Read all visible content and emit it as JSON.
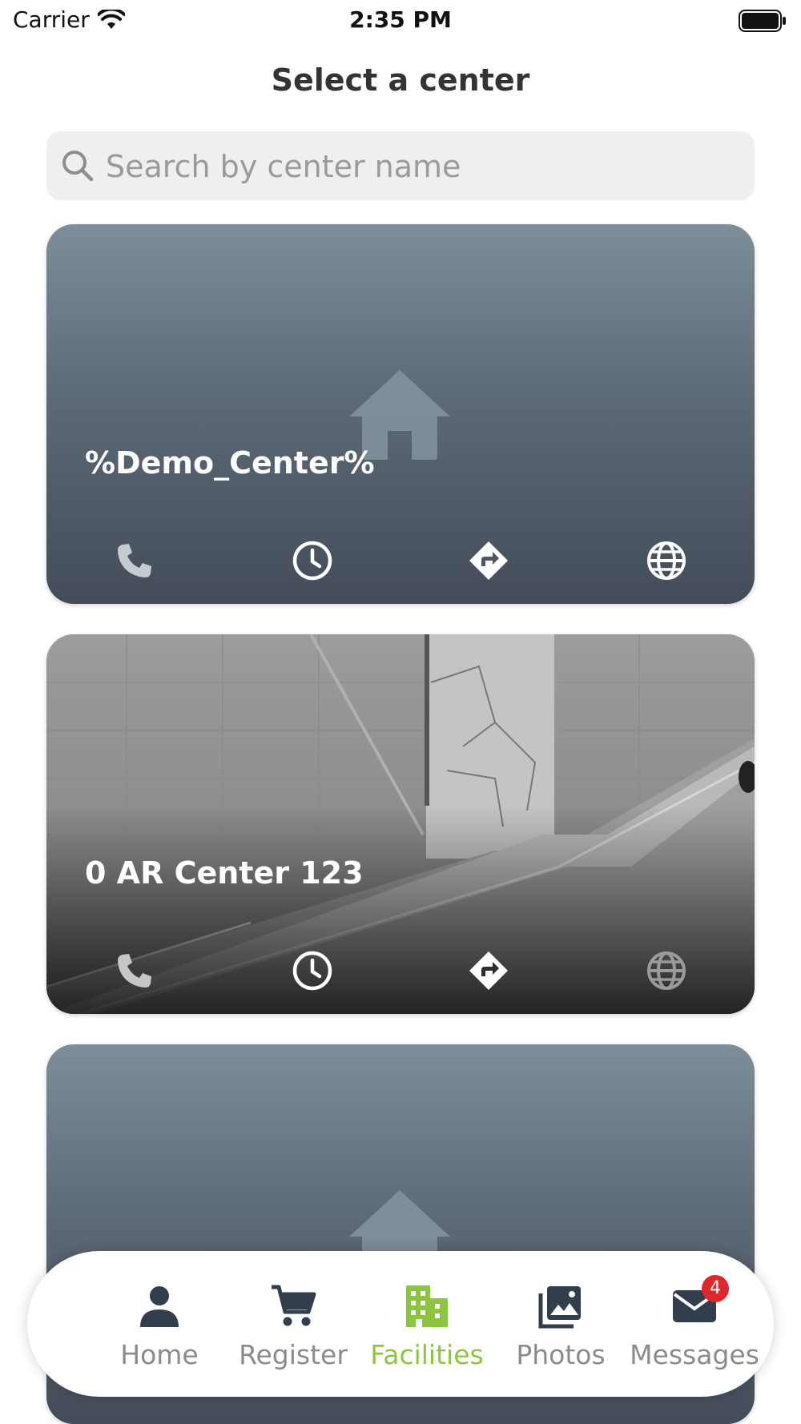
{
  "status_bar": {
    "carrier": "Carrier",
    "time": "2:35 PM"
  },
  "header": {
    "title": "Select a center"
  },
  "search": {
    "placeholder": "Search by center name"
  },
  "centers": [
    {
      "name": "%Demo_Center%",
      "image": "house-placeholder"
    },
    {
      "name": "0 AR Center 123",
      "image": "building-stairs-photo"
    },
    {
      "name": "",
      "image": "house-placeholder"
    }
  ],
  "card_actions": [
    "phone-icon",
    "clock-icon",
    "directions-icon",
    "globe-icon"
  ],
  "tabs": [
    {
      "label": "Home",
      "icon": "person-icon",
      "active": false
    },
    {
      "label": "Register",
      "icon": "cart-icon",
      "active": false
    },
    {
      "label": "Facilities",
      "icon": "building-icon",
      "active": true
    },
    {
      "label": "Photos",
      "icon": "photos-icon",
      "active": false
    },
    {
      "label": "Messages",
      "icon": "mail-icon",
      "active": false,
      "badge": "4"
    }
  ],
  "colors": {
    "accent": "#8cc63f",
    "tab_inactive": "#8b8b8b",
    "badge": "#e0262b",
    "icon_dark": "#333e4c"
  }
}
